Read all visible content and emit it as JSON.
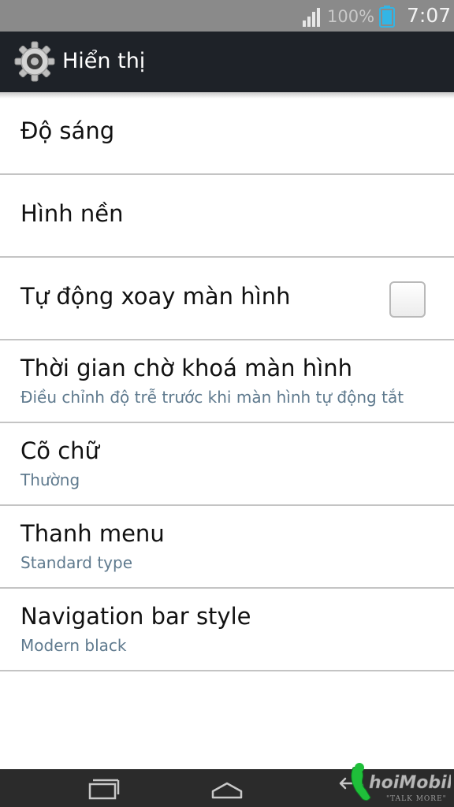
{
  "status_bar": {
    "battery_percent": "100%",
    "time": "7:07",
    "icons": [
      "signal-icon",
      "battery-icon"
    ]
  },
  "action_bar": {
    "title": "Hiển thị",
    "icon": "settings-gear-icon"
  },
  "settings": [
    {
      "title": "Độ sáng",
      "summary": ""
    },
    {
      "title": "Hình nền",
      "summary": ""
    },
    {
      "title": "Tự động xoay màn hình",
      "summary": "",
      "checkbox": false
    },
    {
      "title": "Thời gian chờ khoá màn hình",
      "summary": "Điều chỉnh độ trễ trước khi màn hình tự động tắt"
    },
    {
      "title": "Cõ chữ",
      "summary": "Thường"
    },
    {
      "title": "Thanh menu",
      "summary": "Standard type"
    },
    {
      "title": "Navigation bar style",
      "summary": "Modern black"
    }
  ],
  "nav_bar": {
    "buttons": [
      "recent-apps-icon",
      "home-icon",
      "back-icon"
    ]
  },
  "watermark": {
    "brand": "hoiMobile",
    "tagline": "TALK MORE"
  },
  "colors": {
    "status_bar": "#8a8a8a",
    "action_bar": "#1e2228",
    "summary_text": "#5f7a8e",
    "battery": "#33b5e5"
  }
}
